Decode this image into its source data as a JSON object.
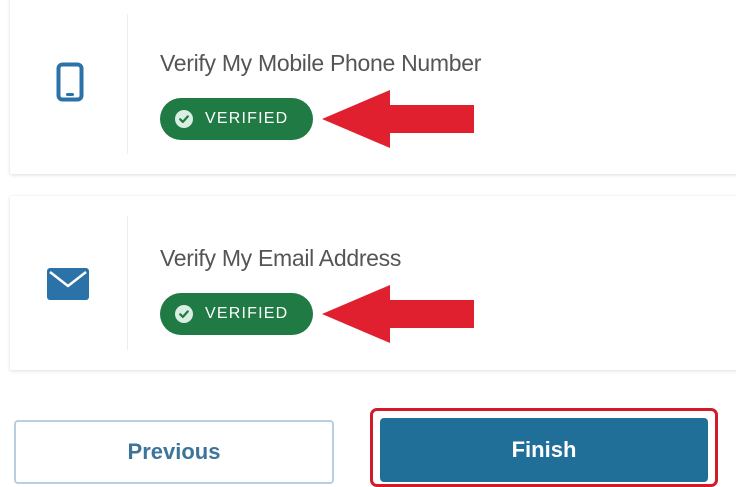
{
  "verifications": [
    {
      "title": "Verify My Mobile Phone Number",
      "icon": "mobile-phone-icon",
      "status": "VERIFIED"
    },
    {
      "title": "Verify My Email Address",
      "icon": "envelope-icon",
      "status": "VERIFIED"
    }
  ],
  "buttons": {
    "previous_label": "Previous",
    "finish_label": "Finish"
  },
  "annotations": {
    "arrow_color": "#e0202e",
    "highlight_color": "#d11a2a"
  },
  "colors": {
    "verified_badge": "#1f7a43",
    "primary": "#1f6f98",
    "icon": "#2a72a8"
  }
}
